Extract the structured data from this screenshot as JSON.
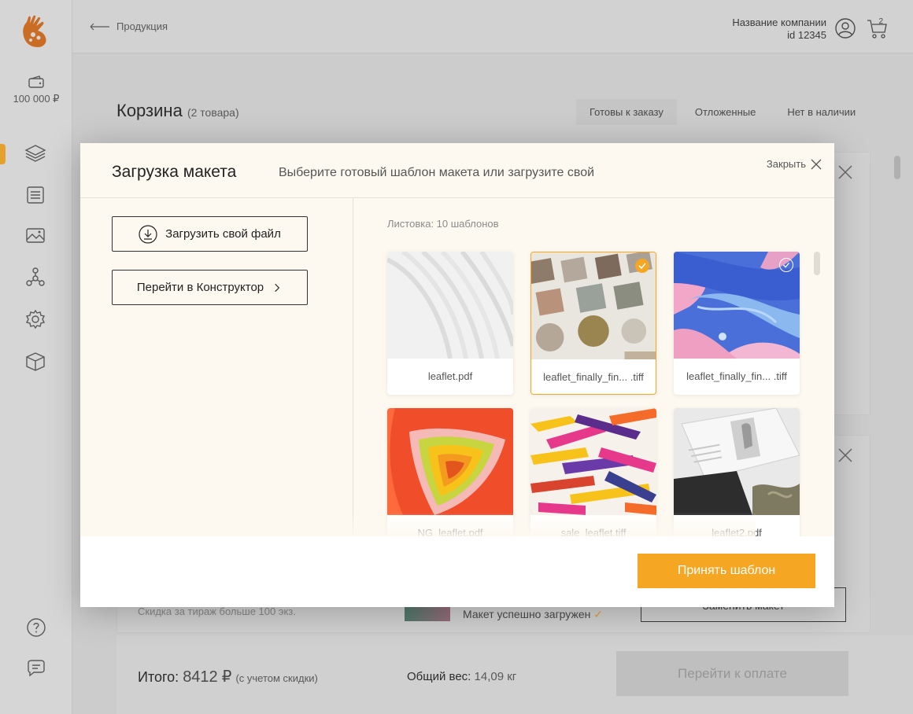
{
  "sidebar": {
    "balance": "100 000 ₽",
    "icons": [
      "layers-icon",
      "list-icon",
      "images-icon",
      "network-icon",
      "gear-icon",
      "box-icon"
    ],
    "bottom_icons": [
      "help-icon",
      "chat-icon"
    ]
  },
  "topbar": {
    "back_label": "Продукция",
    "company_name": "Название компании",
    "company_id": "id 12345",
    "cart_count": "2"
  },
  "page": {
    "title": "Корзина",
    "count": "(2 товара)",
    "tabs": [
      {
        "label": "Готовы к заказу",
        "active": true
      },
      {
        "label": "Отложенные",
        "active": false
      },
      {
        "label": "Нет в наличии",
        "active": false
      }
    ],
    "discount_note": "Скидка за тираж больше 100 экз.",
    "layout_status": "Макет успешно загружен",
    "replace_label": "Заменить макет"
  },
  "footer": {
    "total_label": "Итого:",
    "total_value": "8412",
    "currency": "₽",
    "total_note": "(с учетом скидки)",
    "weight_label": "Общий вес:",
    "weight_value": "14,09 кг",
    "pay_label": "Перейти к оплате"
  },
  "modal": {
    "title": "Загрузка макета",
    "subtitle": "Выберите готовый шаблон макета или загрузите свой",
    "close_label": "Закрыть",
    "upload_label": "Загрузить свой файл",
    "constructor_label": "Перейти в Конструктор",
    "set_label": "Листовка: 10 шаблонов",
    "accept_label": "Принять шаблон",
    "templates": [
      {
        "name": "leaflet.pdf",
        "selected": false,
        "check": "none"
      },
      {
        "name": "leaflet_finally_fin... .tiff",
        "selected": true,
        "check": "on"
      },
      {
        "name": "leaflet_finally_fin... .tiff",
        "selected": false,
        "check": "off"
      },
      {
        "name": "NG_leaflet.pdf",
        "selected": false,
        "check": "none"
      },
      {
        "name": "sale_leaflet.tiff",
        "selected": false,
        "check": "none"
      },
      {
        "name": "leaflet2.pdf",
        "selected": false,
        "check": "none"
      }
    ]
  },
  "colors": {
    "accent": "#f5a623",
    "modal_bg": "#fdf9f0"
  }
}
